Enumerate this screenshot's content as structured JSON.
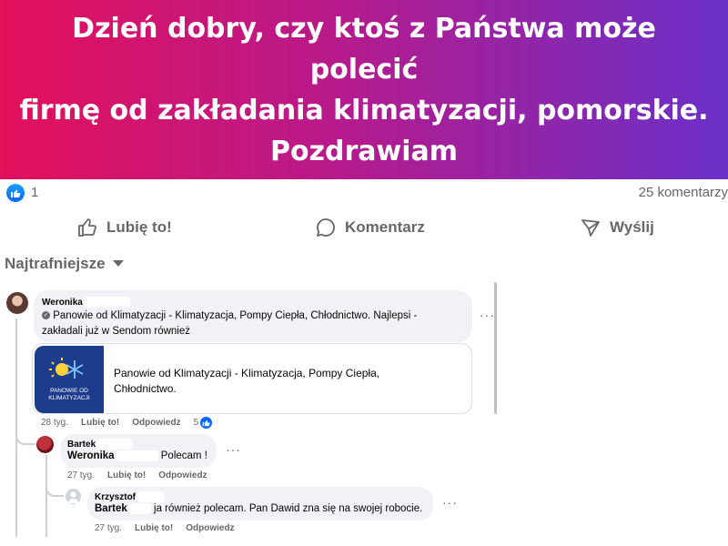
{
  "post": {
    "text": "Dzień dobry, czy ktoś z Państwa może polecić\nfirmę od zakładania klimatyzacji, pomorskie.\nPozdrawiam",
    "gradient_colors": [
      "#e3105a",
      "#6a30c8"
    ]
  },
  "stats": {
    "reactions": "1",
    "comments": "25 komentarzy"
  },
  "actions": {
    "like": "Lubię to!",
    "comment": "Komentarz",
    "share": "Wyślij"
  },
  "sort_label": "Najtrafniejsze",
  "comments": {
    "c1": {
      "author": "Weronika",
      "page_tag": "Panowie od Klimatyzacji - Klimatyzacja, Pompy Ciepła, Chłodnictwo.",
      "text": "Najlepsi - zakładali już w Sendom również",
      "link_preview": {
        "title": "Panowie od Klimatyzacji - Klimatyzacja, Pompy Ciepła, Chłodnictwo.",
        "logo_text_1": "PANOWIE OD",
        "logo_text_2": "KLIMATYZACJI"
      },
      "time": "28 tyg.",
      "like": "Lubię to!",
      "reply": "Odpowiedz",
      "reactions": "5"
    },
    "c2": {
      "author": "Bartek",
      "mention": "Weronika",
      "text": "Polecam !",
      "time": "27 tyg.",
      "like": "Lubię to!",
      "reply": "Odpowiedz"
    },
    "c3": {
      "author": "Krzysztof",
      "mention": "Bartek",
      "text": "ja również polecam. Pan Dawid zna się na swojej robocie.",
      "time": "27 tyg.",
      "like": "Lubię to!",
      "reply": "Odpowiedz"
    }
  },
  "colors": {
    "accent": "#0866ff",
    "muted_text": "#65676b",
    "bubble": "#f0f2f5"
  }
}
